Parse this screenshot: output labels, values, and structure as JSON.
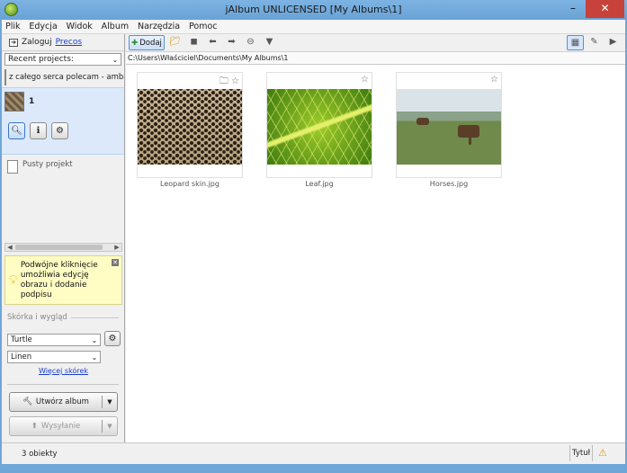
{
  "window": {
    "title": "jAlbum UNLICENSED [My Albums\\1]",
    "min": "–",
    "max": "▢",
    "close": "✕"
  },
  "menu": [
    "Plik",
    "Edycja",
    "Widok",
    "Album",
    "Narzędzia",
    "Pomoc"
  ],
  "sidebar": {
    "login": "Zaloguj",
    "prices": "Precos",
    "recent_label": "Recent projects:",
    "recent_item": "z całego serca polecam - amba",
    "selected_project": "1",
    "empty_project": "Pusty projekt",
    "tip": "Podwójne kliknięcie umożliwia edycję obrazu i dodanie podpisu",
    "skin_section": "Skórka i wygląd",
    "skin": "Turtle",
    "style": "Linen",
    "more_skins": "Więcej skórek",
    "make_album": "Utwórz album",
    "upload": "Wysyłanie"
  },
  "toolbar": {
    "add": "Dodaj"
  },
  "path": "C:\\Users\\Właściciel\\Documents\\My Albums\\1",
  "files": [
    {
      "name": "Leopard skin.jpg"
    },
    {
      "name": "Leaf.jpg"
    },
    {
      "name": "Horses.jpg"
    }
  ],
  "status": {
    "count": "3 obiekty",
    "sort": "Tytuł"
  },
  "colors": {
    "titlebar": "#6ea6d8",
    "close": "#c7423a",
    "tip": "#fffdc4",
    "link": "#1a3fcf"
  }
}
